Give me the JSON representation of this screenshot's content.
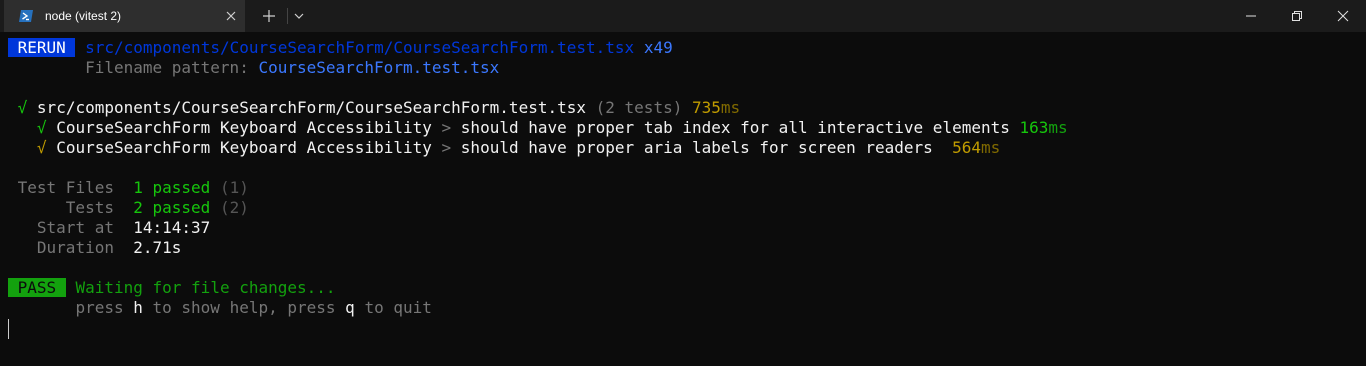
{
  "titlebar": {
    "tab_title": "node (vitest 2)",
    "icons": [
      "powershell-icon",
      "close-icon",
      "plus-icon",
      "chevron-down-icon",
      "minimize-icon",
      "maximize-icon",
      "close-window-icon"
    ]
  },
  "terminal": {
    "rerun": {
      "badge": "RERUN",
      "path": "src/components/CourseSearchForm/CourseSearchForm.test.tsx",
      "count": "x49",
      "pattern_label": "Filename pattern: ",
      "pattern_value": "CourseSearchForm.test.tsx"
    },
    "file_result": {
      "check": "√",
      "path": "src/components/CourseSearchForm/CourseSearchForm.test.tsx",
      "tests": "(2 tests)",
      "time": "735",
      "unit": "ms"
    },
    "tests": [
      {
        "check": "√",
        "suite": "CourseSearchForm Keyboard Accessibility",
        "sep": ">",
        "name": "should have proper tab index for all interactive elements",
        "time": "163",
        "unit": "ms"
      },
      {
        "check": "√",
        "suite": "CourseSearchForm Keyboard Accessibility",
        "sep": ">",
        "name": "should have proper aria labels for screen readers",
        "time": "564",
        "unit": "ms"
      }
    ],
    "summary": {
      "test_files_label": "Test Files",
      "test_files_value": "1 passed",
      "test_files_total": "(1)",
      "tests_label": "Tests",
      "tests_value": "2 passed",
      "tests_total": "(2)",
      "start_label": "Start at",
      "start_value": "14:14:37",
      "duration_label": "Duration",
      "duration_value": "2.71s"
    },
    "status": {
      "badge": "PASS",
      "message": "Waiting for file changes...",
      "help_prefix": "press ",
      "help_key1": "h",
      "help_mid": " to show help, press ",
      "help_key2": "q",
      "help_suffix": " to quit"
    }
  },
  "colors": {
    "background": "#0c0c0c",
    "titlebar": "#1b1b1b",
    "rerun_badge": "#0037da",
    "pass_badge": "#13a10e",
    "green": "#16c60c",
    "yellow": "#c19c00"
  }
}
